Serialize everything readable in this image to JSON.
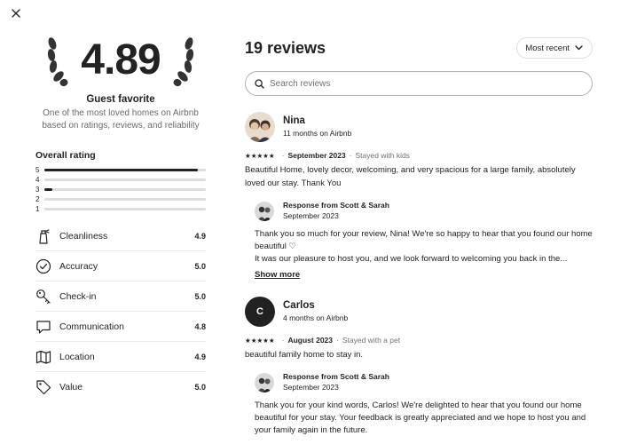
{
  "overall": {
    "score": "4.89",
    "badge_title": "Guest favorite",
    "badge_subtitle": "One of the most loved homes on Airbnb based on ratings, reviews, and reliability",
    "rating_title": "Overall rating",
    "distribution": [
      {
        "star": "5",
        "fraction": 0.95
      },
      {
        "star": "4",
        "fraction": 0.0
      },
      {
        "star": "3",
        "fraction": 0.05
      },
      {
        "star": "2",
        "fraction": 0.0
      },
      {
        "star": "1",
        "fraction": 0.0
      }
    ],
    "categories": [
      {
        "label": "Cleanliness",
        "value": "4.9",
        "icon": "spray-bottle-icon"
      },
      {
        "label": "Accuracy",
        "value": "5.0",
        "icon": "check-circle-icon"
      },
      {
        "label": "Check-in",
        "value": "5.0",
        "icon": "key-icon"
      },
      {
        "label": "Communication",
        "value": "4.8",
        "icon": "message-bubble-icon"
      },
      {
        "label": "Location",
        "value": "4.9",
        "icon": "map-icon"
      },
      {
        "label": "Value",
        "value": "5.0",
        "icon": "tag-icon"
      }
    ]
  },
  "reviews_panel": {
    "title": "19 reviews",
    "sort_label": "Most recent",
    "search_placeholder": "Search reviews",
    "reviews": [
      {
        "name": "Nina",
        "tenure": "11 months on Airbnb",
        "stars": "★★★★★",
        "date": "September 2023",
        "stay": "Stayed with kids",
        "text": "Beautiful Home, lovely decor, welcoming, and very spacious for a large family, absolutely loved our stay. Thank You",
        "response": {
          "name": "Response from Scott & Sarah",
          "date": "September 2023",
          "text": "Thank you so much for your review, Nina! We're so happy to hear that you found our home beautiful ♡",
          "text2": "It was our pleasure to host you, and we look forward to welcoming you back in the...",
          "show_more": "Show more"
        }
      },
      {
        "name": "Carlos",
        "initial": "C",
        "tenure": "4 months on Airbnb",
        "stars": "★★★★★",
        "date": "August 2023",
        "stay": "Stayed with a pet",
        "text": "beautiful family home to stay in.",
        "response": {
          "name": "Response from Scott & Sarah",
          "date": "September 2023",
          "text": "Thank you for your kind words, Carlos! We're delighted to hear that you found our home beautiful for your stay. Your feedback is greatly appreciated and we hope to host you and your family again in the future."
        }
      }
    ]
  }
}
